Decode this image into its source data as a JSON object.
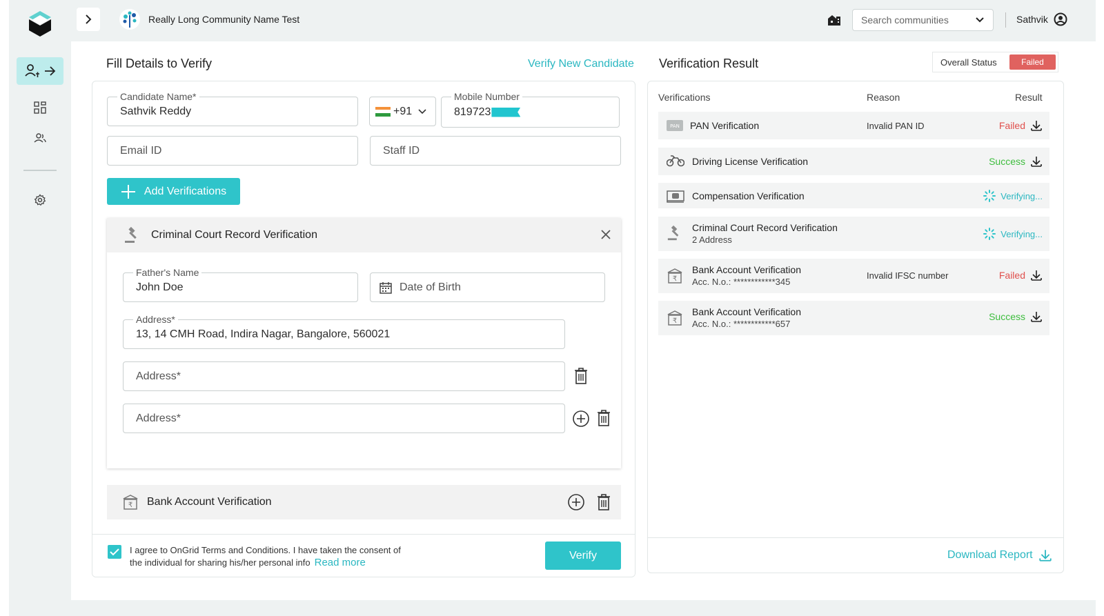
{
  "topbar": {
    "community_name": "Really Long Community Name Test",
    "search_placeholder": "Search communities",
    "user_name": "Sathvik"
  },
  "form": {
    "title": "Fill Details to Verify",
    "verify_new_link": "Verify New Candidate",
    "candidate_name": {
      "label": "Candidate Name*",
      "value": "Sathvik Reddy"
    },
    "country_code": "+91",
    "mobile": {
      "label": "Mobile Number",
      "value": "819723"
    },
    "email_placeholder": "Email ID",
    "staff_placeholder": "Staff ID",
    "add_button": "Add Verifications",
    "criminal_section": {
      "title": "Criminal Court Record Verification",
      "father_name": {
        "label": "Father's Name",
        "value": "John Doe"
      },
      "dob_placeholder": "Date of Birth",
      "address1": {
        "label": "Address*",
        "value": "13, 14 CMH Road, Indira Nagar, Bangalore, 560021"
      },
      "address2_placeholder": "Address*",
      "address3_placeholder": "Address*"
    },
    "bank_section": {
      "title": "Bank Account Verification"
    },
    "consent_text": "I agree to OnGrid Terms and Conditions. I have taken the consent of the individual for sharing his/her personal info",
    "read_more": "Read more",
    "verify_button": "Verify"
  },
  "results": {
    "title": "Verification Result",
    "overall_label": "Overall Status",
    "overall_status": "Failed",
    "headers": {
      "verifications": "Verifications",
      "reason": "Reason",
      "result": "Result"
    },
    "rows": [
      {
        "name": "PAN Verification",
        "sub": "",
        "reason": "Invalid PAN ID",
        "status": "Failed",
        "icon": "pan-card-icon"
      },
      {
        "name": "Driving License Verification",
        "sub": "",
        "reason": "",
        "status": "Success",
        "icon": "bike-icon"
      },
      {
        "name": "Compensation Verification",
        "sub": "",
        "reason": "",
        "status": "Verifying...",
        "icon": "cash-icon"
      },
      {
        "name": "Criminal Court Record Verification",
        "sub": "2 Address",
        "reason": "",
        "status": "Verifying...",
        "icon": "gavel-icon"
      },
      {
        "name": "Bank Account Verification",
        "sub": "Acc. N.o.: ************345",
        "reason": "Invalid IFSC number",
        "status": "Failed",
        "icon": "bank-icon"
      },
      {
        "name": "Bank Account Verification",
        "sub": "Acc. N.o.: ************657",
        "reason": "",
        "status": "Success",
        "icon": "bank-icon"
      }
    ],
    "download_report": "Download Report"
  },
  "colors": {
    "accent": "#2fc4ca",
    "failed": "#e0504d",
    "success": "#3dbd3d",
    "app_bg": "#eef2f2"
  }
}
